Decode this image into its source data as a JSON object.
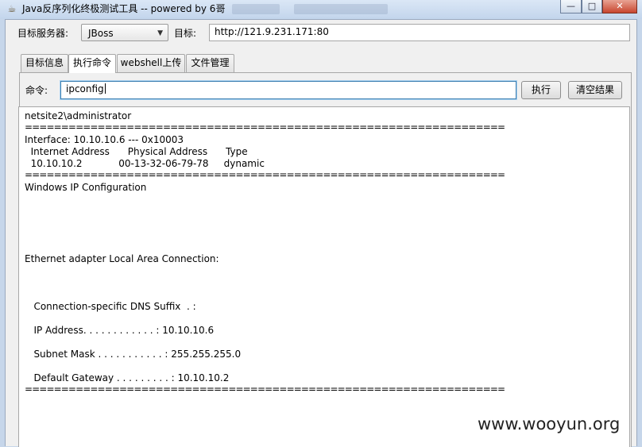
{
  "window": {
    "title": "Java反序列化终极测试工具  -- powered by 6哥",
    "controls": {
      "minimize": "—",
      "maximize": "□",
      "close": "✕"
    }
  },
  "target_row": {
    "server_label": "目标服务器:",
    "server_value": "JBoss",
    "target_label": "目标:",
    "target_value": "http://121.9.231.171:80"
  },
  "tabs": [
    {
      "label": "目标信息",
      "active": false
    },
    {
      "label": "执行命令",
      "active": true
    },
    {
      "label": "webshell上传",
      "active": false
    },
    {
      "label": "文件管理",
      "active": false
    }
  ],
  "command": {
    "label": "命令:",
    "value": "ipconfig",
    "execute_button": "执行",
    "clear_button": "清空结果"
  },
  "output_lines": [
    "netsite2\\administrator",
    "==================================================================",
    "Interface: 10.10.10.6 --- 0x10003",
    "  Internet Address      Physical Address      Type",
    "  10.10.10.2            00-13-32-06-79-78     dynamic",
    "==================================================================",
    "Windows IP Configuration",
    "Ethernet adapter Local Area Connection:",
    "   Connection-specific DNS Suffix  . :",
    "   IP Address. . . . . . . . . . . . : 10.10.10.6",
    "   Subnet Mask . . . . . . . . . . . : 255.255.255.0",
    "   Default Gateway . . . . . . . . . : 10.10.10.2",
    "=================================================================="
  ],
  "watermark": "www.wooyun.org",
  "colors": {
    "titlebar": "#c3d5ec",
    "window_bg": "#f0f0f0",
    "focus_border": "#3c7fb1",
    "close_button": "#c8462f"
  }
}
